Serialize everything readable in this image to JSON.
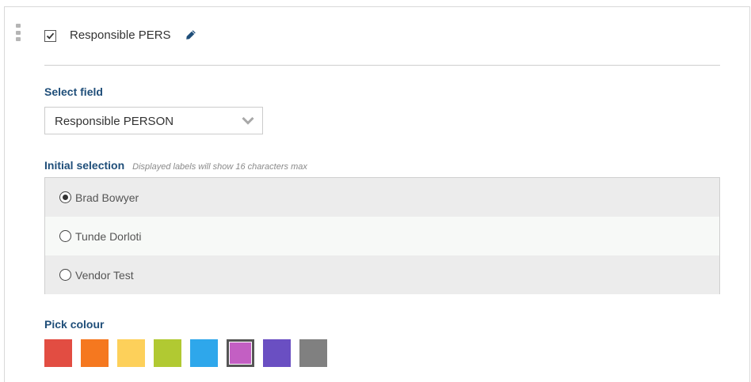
{
  "header": {
    "checkbox_checked": true,
    "title": "Responsible PERS",
    "edit_icon": "pencil-icon"
  },
  "select_field": {
    "label": "Select field",
    "value": "Responsible PERSON",
    "chevron_icon": "chevron-down-icon"
  },
  "initial_selection": {
    "label": "Initial selection",
    "hint": "Displayed labels will show 16 characters max",
    "options": [
      {
        "label": "Brad Bowyer",
        "checked": true
      },
      {
        "label": "Tunde Dorloti",
        "checked": false
      },
      {
        "label": "Vendor Test",
        "checked": false
      }
    ]
  },
  "colour_picker": {
    "label": "Pick colour",
    "colors": [
      "#e24d42",
      "#f5781f",
      "#fdd05a",
      "#b1c932",
      "#2ea7eb",
      "#c35fc3",
      "#6a4fc2",
      "#808080"
    ],
    "selected_index": 5
  }
}
